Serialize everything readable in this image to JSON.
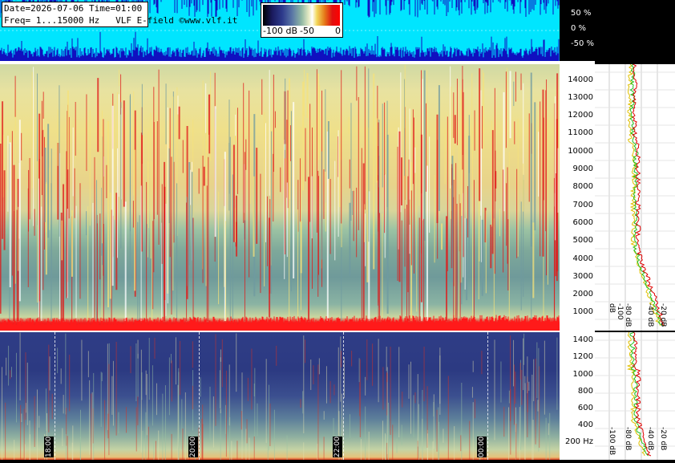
{
  "header": {
    "line1": "Date=2026-07-06 Time=01:00",
    "line2": "Freq= 1...15000 Hz   VLF E-field ©www.vlf.it"
  },
  "scale": {
    "labels": [
      "-100 dB",
      "-50",
      "0"
    ]
  },
  "amplitude_axis": {
    "labels": [
      "50 %",
      "0 %",
      "-50 %"
    ]
  },
  "freq_axis_high": [
    "14000",
    "13000",
    "12000",
    "11000",
    "10000",
    "9000",
    "8000",
    "7000",
    "6000",
    "5000",
    "4000",
    "3000",
    "2000",
    "1000"
  ],
  "freq_axis_low": [
    "1400",
    "1200",
    "1000",
    "800",
    "600",
    "400",
    "200 Hz"
  ],
  "profile_db_labels_high": [
    "-100 dB",
    "-80 dB",
    "-40 dB",
    "-20 dB"
  ],
  "profile_db_labels_low": [
    "-100 dB",
    "-80 dB",
    "-40 dB",
    "-20 dB"
  ],
  "time_labels": [
    "18:00",
    "20:00",
    "22:00",
    "00:00"
  ],
  "colors": {
    "amplitude_bg": "#00e5ff",
    "amplitude_trace": "#1010c0",
    "profile_avg": "#e0c000",
    "profile_peak": "#20c020",
    "profile_red": "#e00000"
  }
}
